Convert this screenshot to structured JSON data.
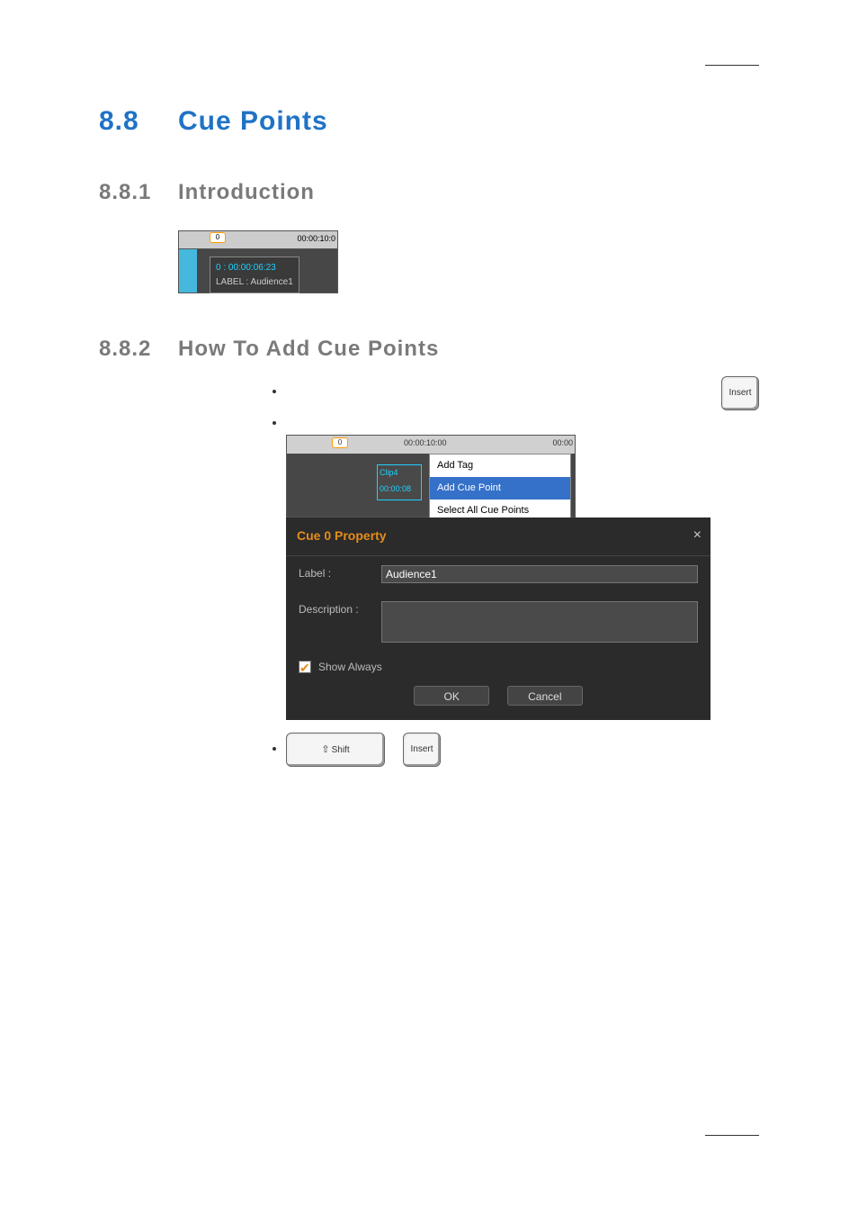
{
  "heading1": {
    "number": "8.8",
    "title": "Cue Points"
  },
  "section1": {
    "number": "8.8.1",
    "title": "Introduction"
  },
  "section2": {
    "number": "8.8.2",
    "title": "How To Add Cue Points"
  },
  "shot1": {
    "ruler_tc": "00:00:10:0",
    "marker": "0",
    "tip_line1": "0 : 00:00:06:23",
    "tip_line2": "LABEL : Audience1"
  },
  "insert_key": "Insert",
  "shot2": {
    "marker": "0",
    "tc1": "00:00:10:00",
    "tc2": "00:00",
    "clip_name": "Clip4",
    "clip_time": "00:00:08",
    "menu": {
      "item1": "Add Tag",
      "item2": "Add Cue Point",
      "item3": "Select All Cue Points"
    }
  },
  "dialog": {
    "title": "Cue 0 Property",
    "label_lbl": "Label :",
    "label_val": "Audience1",
    "desc_lbl": "Description :",
    "show_always": "Show Always",
    "ok": "OK",
    "cancel": "Cancel",
    "close": "×"
  },
  "shift_key": "Shift",
  "insert_key2": "Insert"
}
